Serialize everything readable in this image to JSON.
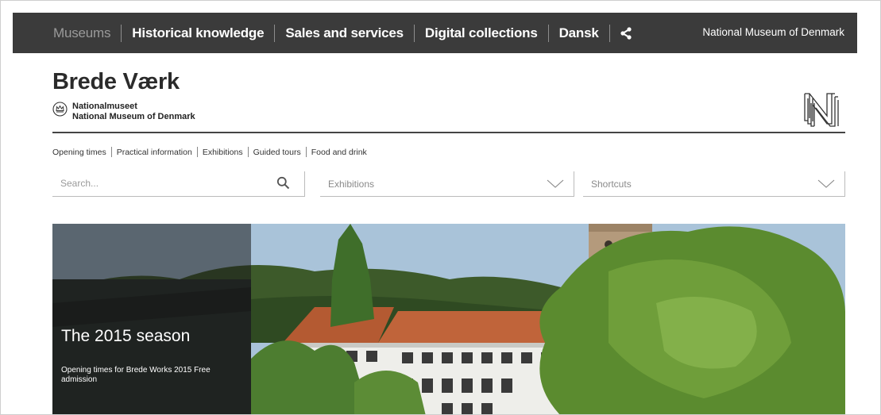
{
  "topnav": {
    "items": [
      "Museums",
      "Historical knowledge",
      "Sales and services",
      "Digital collections",
      "Dansk"
    ],
    "share_icon": "share-icon",
    "brand_link": "National Museum of Denmark"
  },
  "header": {
    "title": "Brede Værk",
    "org_line1": "Nationalmuseet",
    "org_line2": "National Museum of Denmark",
    "crown_icon": "crown-icon",
    "logo_icon": "national-museum-n-logo"
  },
  "subnav": {
    "items": [
      "Opening times",
      "Practical information",
      "Exhibitions",
      "Guided tours",
      "Food and drink"
    ]
  },
  "search": {
    "placeholder": "Search...",
    "icon": "search-icon"
  },
  "dropdowns": {
    "exhibitions": "Exhibitions",
    "shortcuts": "Shortcuts"
  },
  "hero": {
    "title": "The 2015 season",
    "text": "Opening times for Brede Works 2015 Free admission"
  }
}
